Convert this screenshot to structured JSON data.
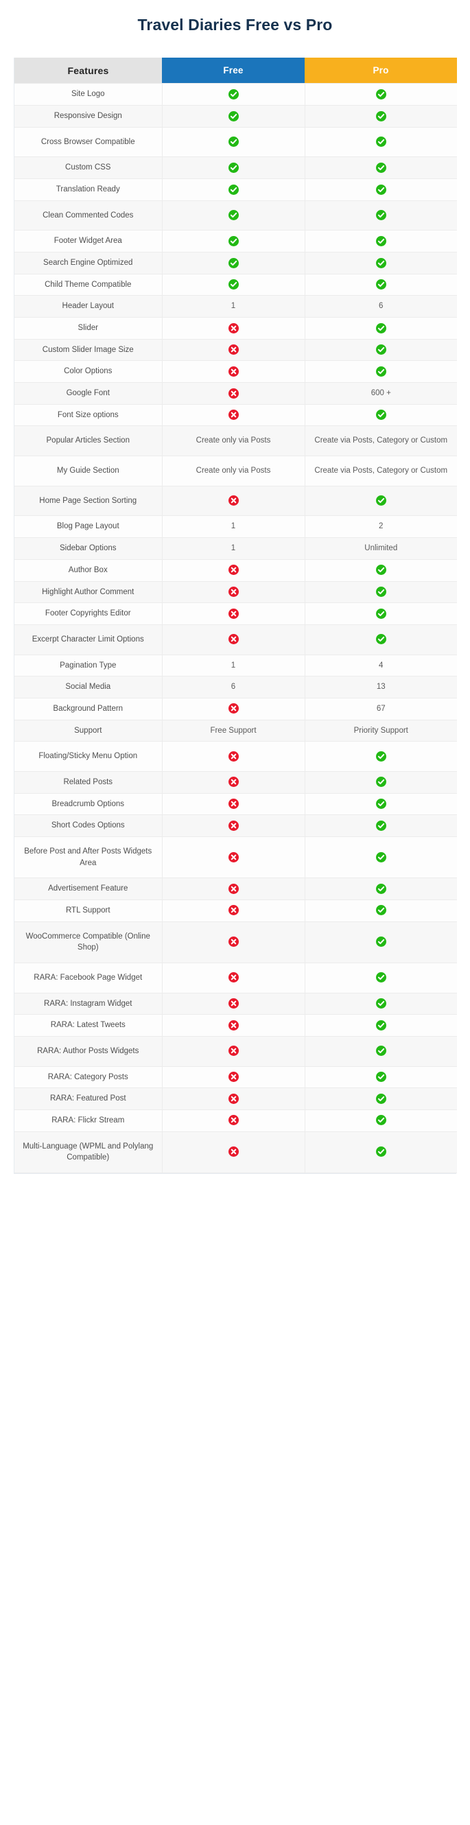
{
  "page": {
    "title": "Travel Diaries Free vs Pro"
  },
  "colors": {
    "title": "#16324f",
    "features_header_bg": "#e3e3e3",
    "free_header_bg": "#1b75bb",
    "pro_header_bg": "#f8b01e",
    "check_green": "#22b914",
    "cross_red": "#e8192c"
  },
  "table": {
    "headers": {
      "features": "Features",
      "free": "Free",
      "pro": "Pro"
    },
    "icons": {
      "yes": "check-circle-icon",
      "no": "cross-circle-icon"
    },
    "rows": [
      {
        "feature": "Site Logo",
        "free": "yes",
        "pro": "yes",
        "tall": false
      },
      {
        "feature": "Responsive Design",
        "free": "yes",
        "pro": "yes",
        "tall": false
      },
      {
        "feature": "Cross Browser Compatible",
        "free": "yes",
        "pro": "yes",
        "tall": true
      },
      {
        "feature": "Custom CSS",
        "free": "yes",
        "pro": "yes",
        "tall": false
      },
      {
        "feature": "Translation Ready",
        "free": "yes",
        "pro": "yes",
        "tall": false
      },
      {
        "feature": "Clean Commented Codes",
        "free": "yes",
        "pro": "yes",
        "tall": true
      },
      {
        "feature": "Footer Widget Area",
        "free": "yes",
        "pro": "yes",
        "tall": false
      },
      {
        "feature": "Search Engine Optimized",
        "free": "yes",
        "pro": "yes",
        "tall": false
      },
      {
        "feature": "Child Theme Compatible",
        "free": "yes",
        "pro": "yes",
        "tall": false
      },
      {
        "feature": "Header Layout",
        "free": "1",
        "pro": "6",
        "tall": false
      },
      {
        "feature": "Slider",
        "free": "no",
        "pro": "yes",
        "tall": false
      },
      {
        "feature": "Custom Slider Image Size",
        "free": "no",
        "pro": "yes",
        "tall": false
      },
      {
        "feature": "Color Options",
        "free": "no",
        "pro": "yes",
        "tall": false
      },
      {
        "feature": "Google Font",
        "free": "no",
        "pro": "600 +",
        "tall": false
      },
      {
        "feature": "Font Size options",
        "free": "no",
        "pro": "yes",
        "tall": false
      },
      {
        "feature": "Popular Articles Section",
        "free": "Create only via Posts",
        "pro": "Create via Posts, Category or Custom",
        "tall": true
      },
      {
        "feature": "My Guide Section",
        "free": "Create only via Posts",
        "pro": "Create via Posts, Category or Custom",
        "tall": true
      },
      {
        "feature": "Home Page Section Sorting",
        "free": "no",
        "pro": "yes",
        "tall": true
      },
      {
        "feature": "Blog Page Layout",
        "free": "1",
        "pro": "2",
        "tall": false
      },
      {
        "feature": "Sidebar Options",
        "free": "1",
        "pro": "Unlimited",
        "tall": false
      },
      {
        "feature": "Author Box",
        "free": "no",
        "pro": "yes",
        "tall": false
      },
      {
        "feature": "Highlight Author Comment",
        "free": "no",
        "pro": "yes",
        "tall": false
      },
      {
        "feature": "Footer Copyrights Editor",
        "free": "no",
        "pro": "yes",
        "tall": false
      },
      {
        "feature": "Excerpt Character Limit Options",
        "free": "no",
        "pro": "yes",
        "tall": true
      },
      {
        "feature": "Pagination Type",
        "free": "1",
        "pro": "4",
        "tall": false
      },
      {
        "feature": "Social Media",
        "free": "6",
        "pro": "13",
        "tall": false
      },
      {
        "feature": "Background Pattern",
        "free": "no",
        "pro": "67",
        "tall": false
      },
      {
        "feature": "Support",
        "free": "Free Support",
        "pro": "Priority Support",
        "tall": false
      },
      {
        "feature": "Floating/Sticky Menu Option",
        "free": "no",
        "pro": "yes",
        "tall": true
      },
      {
        "feature": "Related Posts",
        "free": "no",
        "pro": "yes",
        "tall": false
      },
      {
        "feature": "Breadcrumb Options",
        "free": "no",
        "pro": "yes",
        "tall": false
      },
      {
        "feature": "Short Codes Options",
        "free": "no",
        "pro": "yes",
        "tall": false
      },
      {
        "feature": "Before Post and After Posts Widgets Area",
        "free": "no",
        "pro": "yes",
        "tall": true
      },
      {
        "feature": "Advertisement Feature",
        "free": "no",
        "pro": "yes",
        "tall": false
      },
      {
        "feature": "RTL Support",
        "free": "no",
        "pro": "yes",
        "tall": false
      },
      {
        "feature": "WooCommerce Compatible (Online Shop)",
        "free": "no",
        "pro": "yes",
        "tall": true
      },
      {
        "feature": "RARA: Facebook Page Widget",
        "free": "no",
        "pro": "yes",
        "tall": true
      },
      {
        "feature": "RARA: Instagram Widget",
        "free": "no",
        "pro": "yes",
        "tall": false
      },
      {
        "feature": "RARA: Latest Tweets",
        "free": "no",
        "pro": "yes",
        "tall": false
      },
      {
        "feature": "RARA: Author Posts Widgets",
        "free": "no",
        "pro": "yes",
        "tall": true
      },
      {
        "feature": "RARA: Category Posts",
        "free": "no",
        "pro": "yes",
        "tall": false
      },
      {
        "feature": "RARA: Featured Post",
        "free": "no",
        "pro": "yes",
        "tall": false
      },
      {
        "feature": "RARA: Flickr Stream",
        "free": "no",
        "pro": "yes",
        "tall": false
      },
      {
        "feature": "Multi-Language (WPML and Polylang Compatible)",
        "free": "no",
        "pro": "yes",
        "tall": true
      }
    ]
  }
}
